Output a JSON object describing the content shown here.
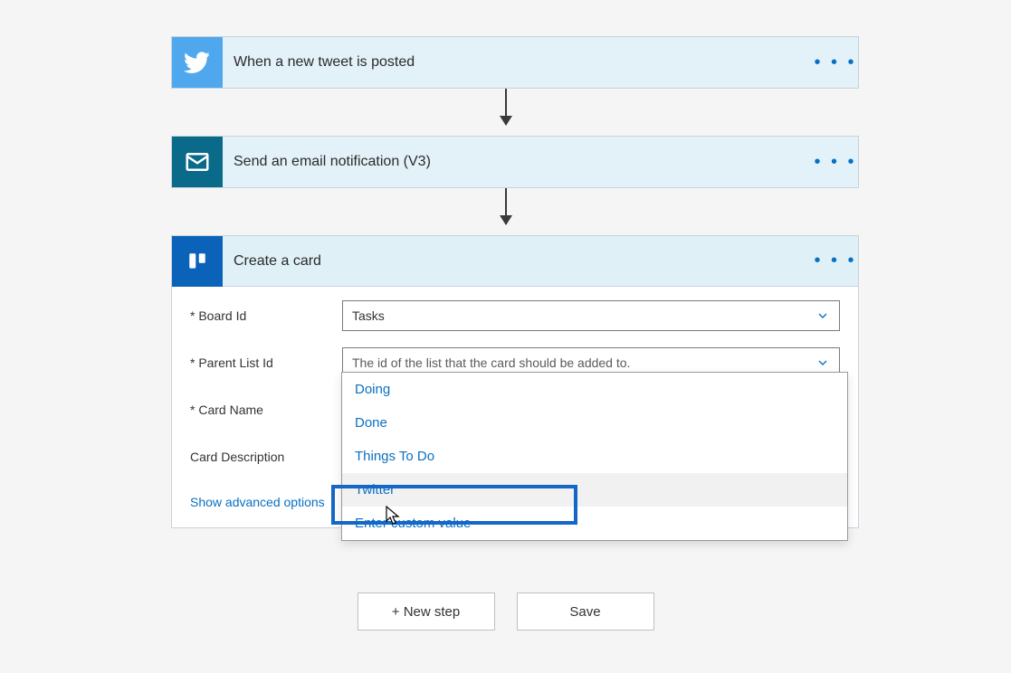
{
  "steps": {
    "twitter": {
      "title": "When a new tweet is posted"
    },
    "email": {
      "title": "Send an email notification (V3)"
    },
    "trello": {
      "title": "Create a card"
    }
  },
  "form": {
    "board_id": {
      "label": "Board Id",
      "value": "Tasks"
    },
    "parent_list_id": {
      "label": "Parent List Id",
      "placeholder": "The id of the list that the card should be added to."
    },
    "card_name": {
      "label": "Card Name"
    },
    "card_description": {
      "label": "Card Description"
    },
    "advanced_link": "Show advanced options"
  },
  "dropdown": {
    "items": [
      "Doing",
      "Done",
      "Things To Do",
      "Twitter",
      "Enter custom value"
    ]
  },
  "footer": {
    "new_step": "+ New step",
    "save": "Save"
  },
  "ellipsis": "• • •"
}
